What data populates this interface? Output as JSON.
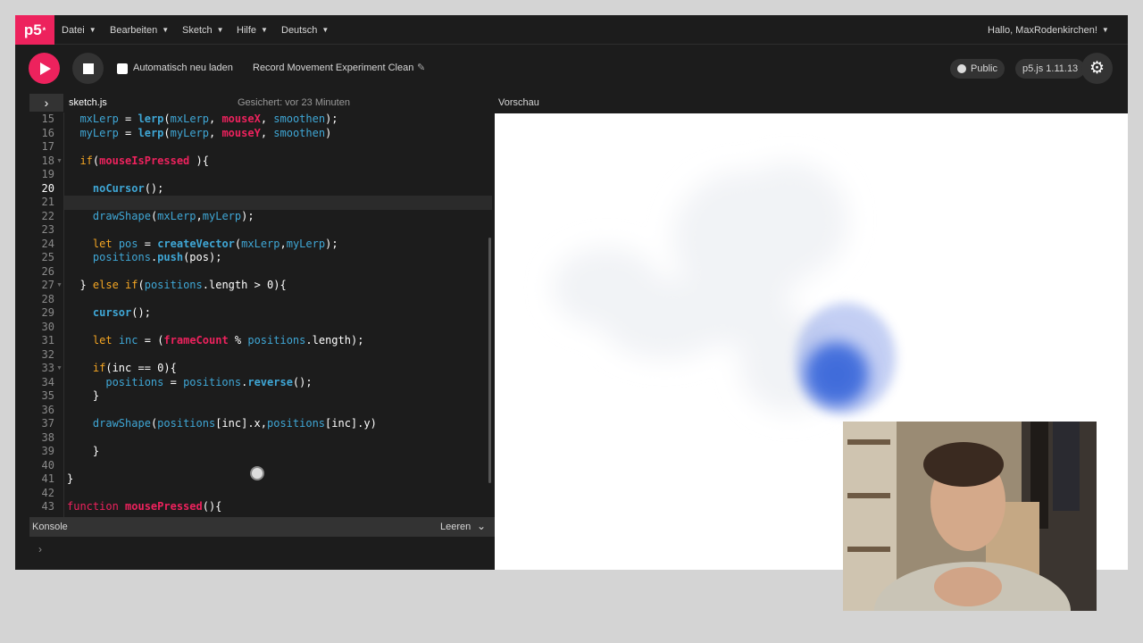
{
  "menu": {
    "logo": "p5",
    "logo_sup": "*",
    "items": [
      "Datei",
      "Bearbeiten",
      "Sketch",
      "Hilfe",
      "Deutsch"
    ],
    "greeting": "Hallo, MaxRodenkirchen!"
  },
  "toolbar": {
    "autoreload_label": "Automatisch neu laden",
    "project_name": "Record Movement Experiment Clean",
    "visibility": "Public",
    "version": "p5.js 1.11.13"
  },
  "editor": {
    "file_name": "sketch.js",
    "saved_status": "Gesichert: vor 23 Minuten",
    "preview_label": "Vorschau",
    "line_numbers": [
      "15",
      "16",
      "17",
      "18",
      "19",
      "20",
      "21",
      "22",
      "23",
      "24",
      "25",
      "26",
      "27",
      "28",
      "29",
      "30",
      "31",
      "32",
      "33",
      "34",
      "35",
      "36",
      "37",
      "38",
      "39",
      "40",
      "41",
      "42",
      "43"
    ]
  },
  "console": {
    "label": "Konsole",
    "clear": "Leeren"
  },
  "colors": {
    "accent": "#ed225d",
    "editor_bg": "#1c1c1c"
  }
}
